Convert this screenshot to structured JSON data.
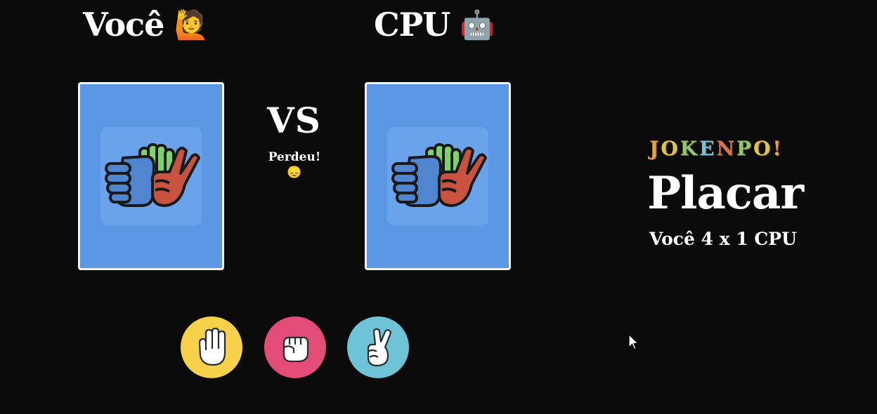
{
  "player": {
    "title": "Você",
    "emoji": "🙋"
  },
  "cpu": {
    "title": "CPU",
    "emoji": "🤖"
  },
  "versus": {
    "label": "VS",
    "result": "Perdeu!",
    "result_emoji": "😞"
  },
  "choices": [
    {
      "name": "paper",
      "color": "#f7d14a"
    },
    {
      "name": "rock",
      "color": "#e34c77"
    },
    {
      "name": "scissors",
      "color": "#6fc3d6"
    }
  ],
  "scoreboard": {
    "logo_letters": [
      "J",
      "O",
      "K",
      "E",
      "N",
      "P",
      "O",
      "!"
    ],
    "logo_colors": [
      "#e8a049",
      "#e0c24e",
      "#8fc76a",
      "#6fc1e0",
      "#d9734e",
      "#8fc76a",
      "#e0c24e",
      "#e8a049"
    ],
    "title": "Placar",
    "score": "Você 4 x 1 CPU"
  }
}
